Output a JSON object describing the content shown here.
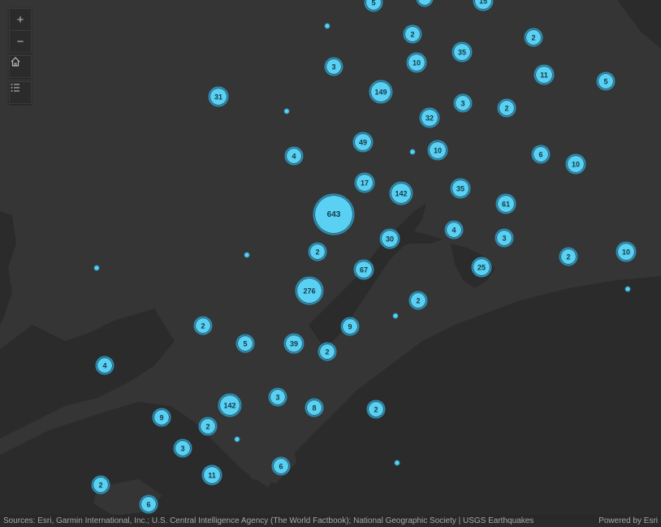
{
  "map": {
    "background_color": "#353535",
    "land_color": "#2b2b2b",
    "cluster_fill": "#5ad0f2",
    "cluster_stroke": "#2a8fb5",
    "label_color": "#123a4a"
  },
  "controls": {
    "zoom_in_label": "+",
    "zoom_out_label": "−",
    "home_icon": "home-icon",
    "layer_list_icon": "list-icon"
  },
  "clusters": [
    {
      "count": "5"
    },
    {
      "count": ""
    },
    {
      "count": "15"
    },
    {
      "count": "2"
    },
    {
      "count": "2"
    },
    {
      "count": "3"
    },
    {
      "count": "10"
    },
    {
      "count": "35"
    },
    {
      "count": "11"
    },
    {
      "count": "5"
    },
    {
      "count": "31"
    },
    {
      "count": "149"
    },
    {
      "count": "3"
    },
    {
      "count": "2"
    },
    {
      "count": "32"
    },
    {
      "count": "49"
    },
    {
      "count": "10"
    },
    {
      "count": "6"
    },
    {
      "count": "10"
    },
    {
      "count": "4"
    },
    {
      "count": "17"
    },
    {
      "count": "142"
    },
    {
      "count": "35"
    },
    {
      "count": "61"
    },
    {
      "count": "643"
    },
    {
      "count": "4"
    },
    {
      "count": "3"
    },
    {
      "count": "30"
    },
    {
      "count": "2"
    },
    {
      "count": "67"
    },
    {
      "count": "25"
    },
    {
      "count": "2"
    },
    {
      "count": "10"
    },
    {
      "count": "276"
    },
    {
      "count": "2"
    },
    {
      "count": "2"
    },
    {
      "count": "9"
    },
    {
      "count": "5"
    },
    {
      "count": "39"
    },
    {
      "count": "2"
    },
    {
      "count": "4"
    },
    {
      "count": "3"
    },
    {
      "count": "142"
    },
    {
      "count": "8"
    },
    {
      "count": "2"
    },
    {
      "count": "9"
    },
    {
      "count": "2"
    },
    {
      "count": "3"
    },
    {
      "count": "11"
    },
    {
      "count": "6"
    },
    {
      "count": "2"
    },
    {
      "count": "6"
    }
  ],
  "attribution": {
    "text": "Sources: Esri, Garmin International, Inc.; U.S. Central Intelligence Agency (The World Factbook); National Geographic Society | USGS Earthquakes",
    "powered_by": "Powered by Esri"
  }
}
